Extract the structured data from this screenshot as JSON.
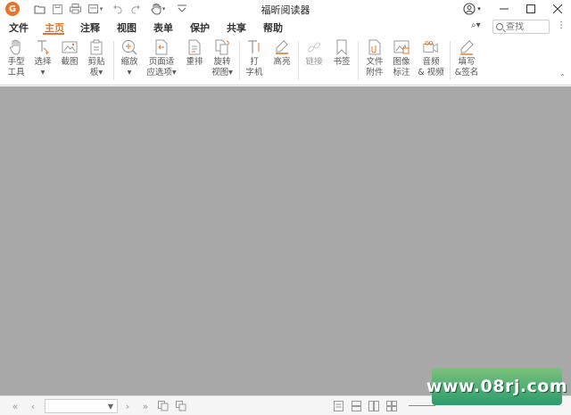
{
  "titlebar": {
    "title": "福昕阅读器",
    "logo_text": "G",
    "quick_access": [
      "open-folder-icon",
      "save-icon",
      "print-icon",
      "new-doc-icon",
      "undo-icon",
      "redo-icon",
      "hand-tool-icon",
      "customize-icon"
    ],
    "window_controls": [
      "account-icon",
      "minimize-icon",
      "maximize-icon",
      "close-icon"
    ]
  },
  "menu": {
    "tabs": [
      "文件",
      "主页",
      "注释",
      "视图",
      "表单",
      "保护",
      "共享",
      "帮助"
    ],
    "active_tab": "主页",
    "search_placeholder": "查找",
    "find_label": "⌕▾"
  },
  "ribbon": {
    "buttons": [
      {
        "label": "手型\n工具"
      },
      {
        "label": "选择\n▾"
      },
      {
        "label": "截图"
      },
      {
        "label": "剪贴\n板▾"
      },
      {
        "label": "缩放\n▾"
      },
      {
        "label": "页面适\n应选项▾"
      },
      {
        "label": "重排"
      },
      {
        "label": "旋转\n视图▾"
      },
      {
        "label": "打\n字机"
      },
      {
        "label": "高亮"
      },
      {
        "label": "链接"
      },
      {
        "label": "书签"
      },
      {
        "label": "文件\n附件"
      },
      {
        "label": "图像\n标注"
      },
      {
        "label": "音频\n& 视频"
      },
      {
        "label": "填写\n&签名"
      }
    ]
  },
  "statusbar": {
    "page_value": "",
    "view_modes": [
      "single-page-icon",
      "continuous-icon",
      "facing-icon",
      "cover-icon"
    ]
  },
  "watermark": {
    "text": "www.08rj.com"
  },
  "colors": {
    "accent": "#e8742b",
    "canvas": "#a8a8a8",
    "watermark": "#2d9b6b"
  }
}
